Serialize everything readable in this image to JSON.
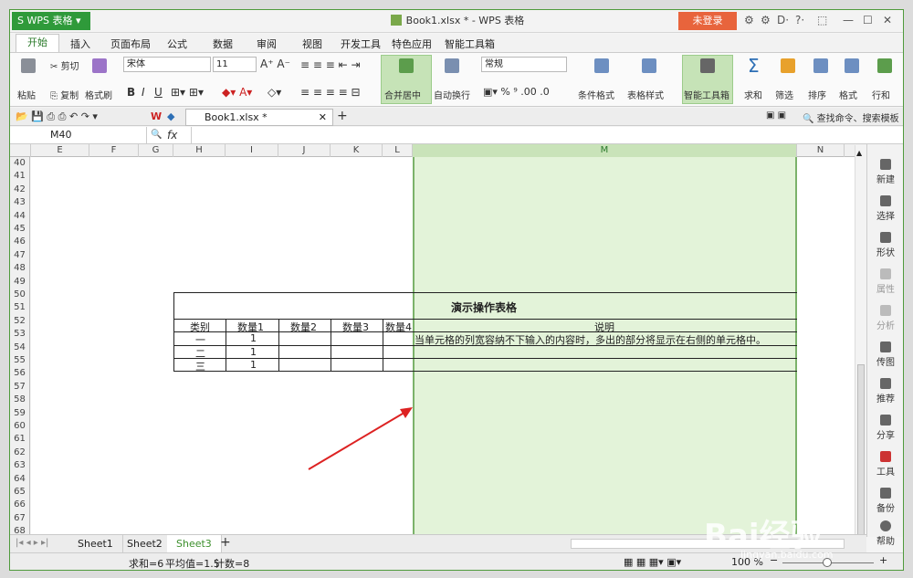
{
  "app": {
    "name": "WPS 表格",
    "title": "Book1.xlsx * - WPS 表格",
    "login": "未登录"
  },
  "menu": [
    "开始",
    "插入",
    "页面布局",
    "公式",
    "数据",
    "审阅",
    "视图",
    "开发工具",
    "特色应用",
    "智能工具箱"
  ],
  "ribbon": {
    "paste": "粘贴",
    "cut": "剪切",
    "copy": "复制",
    "format_painter": "格式刷",
    "font": "宋体",
    "size": "11",
    "merge": "合并居中",
    "wrap": "自动换行",
    "number_format": "常规",
    "cond_format": "条件格式",
    "table_style": "表格样式",
    "smart_toolbox": "智能工具箱",
    "sum": "求和",
    "filter": "筛选",
    "sort": "排序",
    "format": "格式",
    "row_col": "行和"
  },
  "doc_tab": "Book1.xlsx *",
  "search": "查找命令、搜索模板",
  "namebox": "M40",
  "fx": "fx",
  "columns": [
    "E",
    "F",
    "G",
    "H",
    "I",
    "J",
    "K",
    "L",
    "M",
    "N"
  ],
  "rows": [
    "40",
    "41",
    "42",
    "43",
    "44",
    "45",
    "46",
    "47",
    "48",
    "49",
    "50",
    "51",
    "52",
    "53",
    "54",
    "55",
    "56",
    "57",
    "58",
    "59",
    "60",
    "61",
    "62",
    "63",
    "64",
    "65",
    "66",
    "67",
    "68"
  ],
  "table": {
    "title": "演示操作表格",
    "headers": [
      "类别",
      "数量1",
      "数量2",
      "数量3",
      "数量4",
      "说明"
    ],
    "rows": [
      [
        "一",
        "1"
      ],
      [
        "二",
        "1"
      ],
      [
        "三",
        "1"
      ]
    ],
    "note": "当单元格的列宽容纳不下输入的内容时，多出的部分将显示在右侧的单元格中。"
  },
  "sidebar": [
    "新建",
    "选择",
    "形状",
    "属性",
    "分析",
    "传图",
    "推荐",
    "分享",
    "工具",
    "备份",
    "帮助"
  ],
  "sheets": [
    "Sheet1",
    "Sheet2",
    "Sheet3"
  ],
  "status": {
    "sum": "求和=6",
    "avg": "平均值=1.5",
    "count": "计数=8",
    "zoom": "100 %"
  },
  "watermark": {
    "brand": "Bai经验",
    "url": "jingyan.baidu.com"
  }
}
